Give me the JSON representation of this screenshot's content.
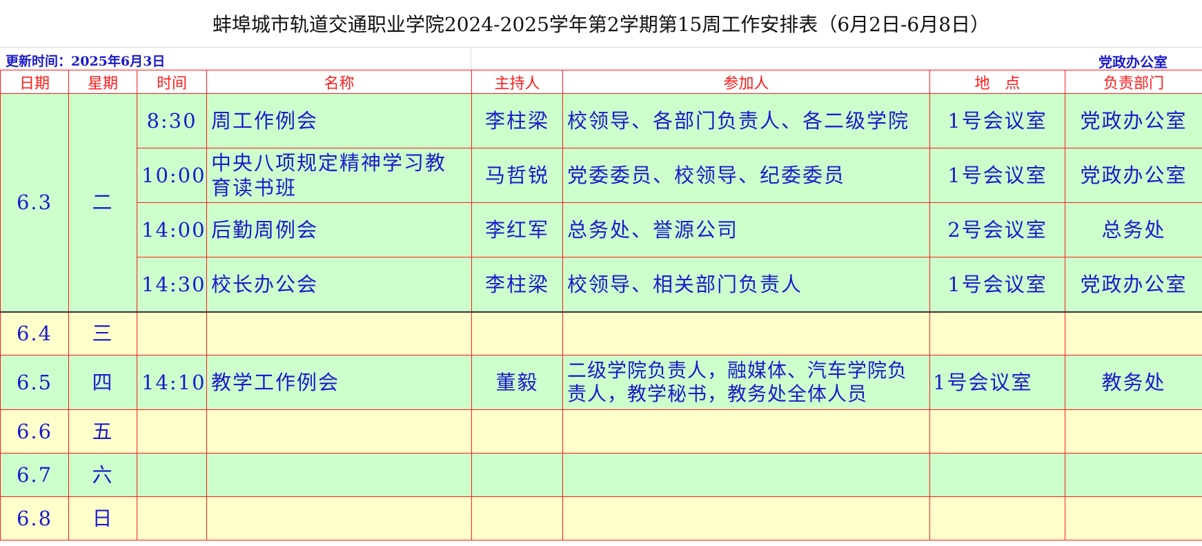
{
  "title": "蚌埠城市轨道交通职业学院2024-2025学年第2学期第15周工作安排表（6月2日-6月8日）",
  "update_time": "更新时间：2025年6月3日",
  "office": "党政办公室",
  "headers": [
    "日期",
    "星期",
    "时间",
    "名称",
    "主持人",
    "参加人",
    "地　点",
    "负责部门"
  ],
  "day1": {
    "date": "6.3",
    "weekday": "二",
    "events": [
      {
        "time": "8:30",
        "name": "周工作例会",
        "host": "李柱梁",
        "participants": "校领导、各部门负责人、各二级学院",
        "location": "1号会议室",
        "dept": "党政办公室"
      },
      {
        "time": "10:00",
        "name": "中央八项规定精神学习教育读书班",
        "host": "马哲锐",
        "participants": "党委委员、校领导、纪委委员",
        "location": "1号会议室",
        "dept": "党政办公室"
      },
      {
        "time": "14:00",
        "name": "后勤周例会",
        "host": "李红军",
        "participants": "总务处、誉源公司",
        "location": "2号会议室",
        "dept": "总务处"
      },
      {
        "time": "14:30",
        "name": "校长办公会",
        "host": "李柱梁",
        "participants": "校领导、相关部门负责人",
        "location": "1号会议室",
        "dept": "党政办公室"
      }
    ]
  },
  "day2": {
    "date": "6.4",
    "weekday": "三"
  },
  "day3": {
    "date": "6.5",
    "weekday": "四",
    "time": "14:10",
    "name": "教学工作例会",
    "host": "董毅",
    "participants": "二级学院负责人，融媒体、汽车学院负责人，教学秘书，教务处全体人员",
    "location": "1号会议室",
    "dept": "教务处"
  },
  "day4": {
    "date": "6.6",
    "weekday": "五"
  },
  "day5": {
    "date": "6.7",
    "weekday": "六"
  },
  "day6": {
    "date": "6.8",
    "weekday": "日"
  },
  "colors": {
    "header_text": "#ff1a1a",
    "body_text": "#1a1acc",
    "green_row": "#ccffcc",
    "yellow_row": "#ffffcc",
    "border": "#ff1a1a"
  }
}
